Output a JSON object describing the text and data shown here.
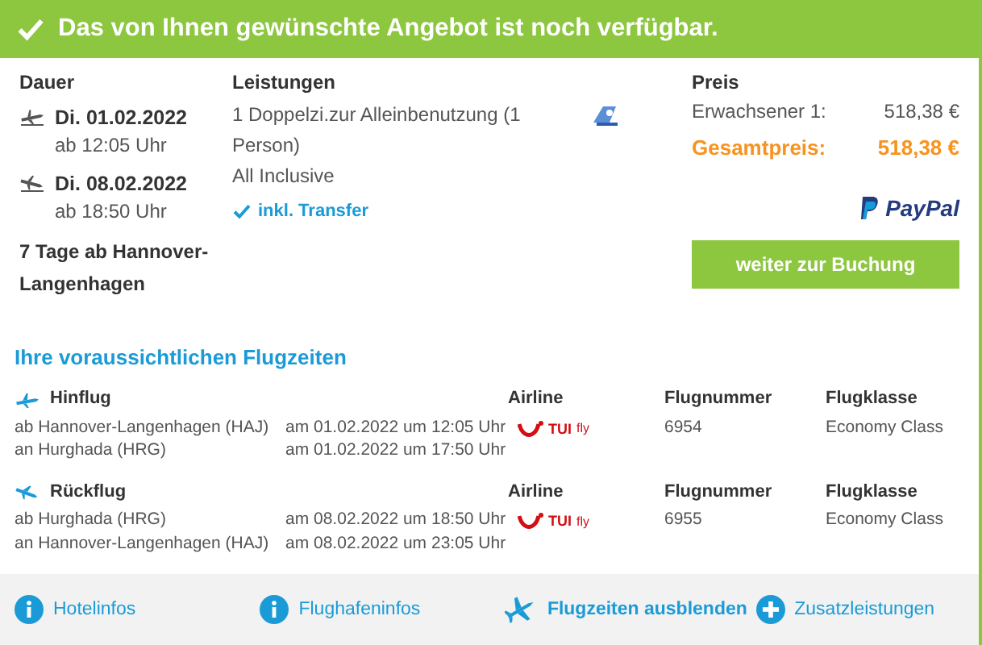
{
  "banner": {
    "text": "Das von Ihnen gewünschte Angebot ist noch verfügbar."
  },
  "duration": {
    "label": "Dauer",
    "legs": [
      {
        "kind": "departure",
        "date": "Di. 01.02.2022",
        "time": "ab 12:05 Uhr"
      },
      {
        "kind": "return",
        "date": "Di. 08.02.2022",
        "time": "ab 18:50 Uhr"
      }
    ],
    "summary": "7 Tage ab Hannover-Langenhagen"
  },
  "services": {
    "label": "Leistungen",
    "items": [
      "1 Doppelzi.zur Alleinbenutzung (1 Person)",
      "All Inclusive"
    ],
    "transfer": "inkl. Transfer"
  },
  "price": {
    "label": "Preis",
    "lines": [
      {
        "label": "Erwachsener 1:",
        "amount": "518,38 €"
      }
    ],
    "total_label": "Gesamtpreis:",
    "total": "518,38 €",
    "payment": "PayPal",
    "button": "weiter zur Buchung"
  },
  "flights": {
    "title": "Ihre voraussichtlichen Flugzeiten",
    "legs": [
      {
        "kind": "outbound",
        "name": "Hinflug",
        "rows": [
          {
            "place": "ab Hannover-Langenhagen (HAJ)",
            "time": "am 01.02.2022 um 12:05 Uhr"
          },
          {
            "place": "an Hurghada (HRG)",
            "time": "am 01.02.2022 um 17:50 Uhr"
          }
        ],
        "airline_label": "Airline",
        "airline_logo": {
          "mark": "TUI",
          "suffix": "fly"
        },
        "number_label": "Flugnummer",
        "number": "6954",
        "class_label": "Flugklasse",
        "class": "Economy Class"
      },
      {
        "kind": "return",
        "name": "Rückflug",
        "rows": [
          {
            "place": "ab Hurghada (HRG)",
            "time": "am 08.02.2022 um 18:50 Uhr"
          },
          {
            "place": "an Hannover-Langenhagen (HAJ)",
            "time": "am 08.02.2022 um 23:05 Uhr"
          }
        ],
        "airline_label": "Airline",
        "airline_logo": {
          "mark": "TUI",
          "suffix": "fly"
        },
        "number_label": "Flugnummer",
        "number": "6955",
        "class_label": "Flugklasse",
        "class": "Economy Class"
      }
    ]
  },
  "footer_links": [
    {
      "kind": "info",
      "label": "Hotelinfos"
    },
    {
      "kind": "info",
      "label": "Flughafeninfos"
    },
    {
      "kind": "plane",
      "label": "Flugzeiten ausblenden"
    },
    {
      "kind": "plus",
      "label": "Zusatzleistungen"
    }
  ]
}
